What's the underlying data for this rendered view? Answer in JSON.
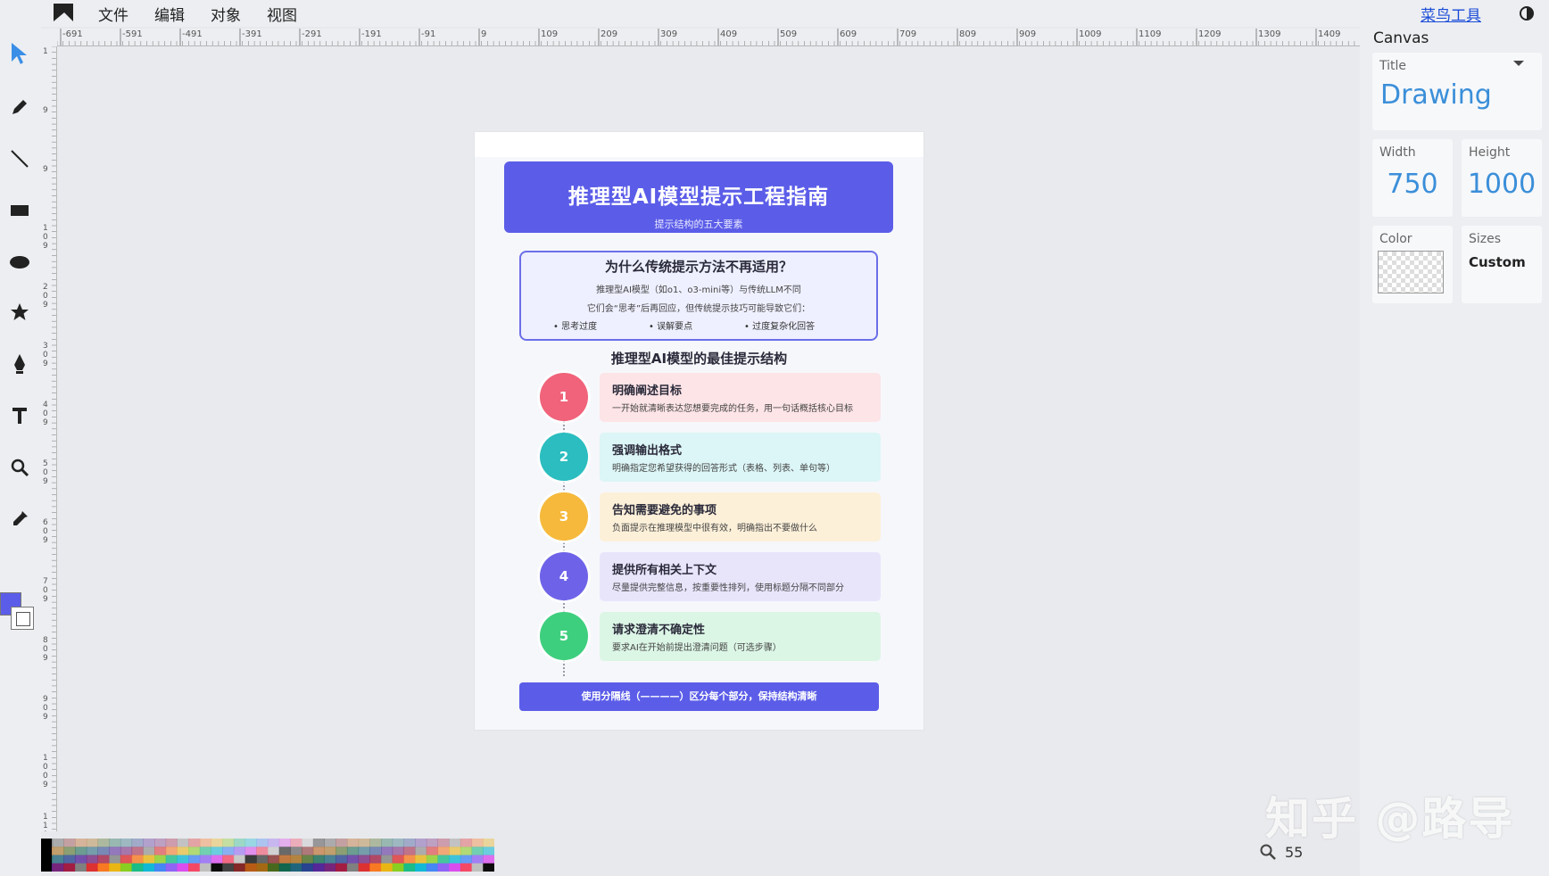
{
  "menubar": {
    "items": [
      "文件",
      "编辑",
      "对象",
      "视图"
    ],
    "brand_link": "菜鸟工具"
  },
  "tools": [
    "select-icon",
    "pencil-icon",
    "line-icon",
    "rectangle-icon",
    "ellipse-icon",
    "star-icon",
    "pen-icon",
    "text-icon",
    "zoom-icon",
    "eyedropper-icon"
  ],
  "rulers": {
    "h_labels": [
      "-691",
      "-591",
      "-491",
      "-391",
      "-291",
      "-191",
      "-91",
      "9",
      "109",
      "209",
      "309",
      "409",
      "509",
      "609",
      "709",
      "809",
      "909",
      "1009",
      "1109",
      "1209",
      "1309",
      "1409"
    ],
    "v_labels": [
      "1",
      "9",
      "9",
      "1 0 9",
      "2 0 9",
      "3 0 9",
      "4 0 9",
      "5 0 9",
      "6 0 9",
      "7 0 9",
      "8 0 9",
      "9 0 9",
      "1 0 0 9",
      "1 1 0 9"
    ]
  },
  "canvas_panel": {
    "heading": "Canvas",
    "title_label": "Title",
    "title_value": "Drawing",
    "width_label": "Width",
    "width_value": "750",
    "height_label": "Height",
    "height_value": "1000",
    "color_label": "Color",
    "sizes_label": "Sizes",
    "sizes_value": "Custom"
  },
  "poster": {
    "title": "推理型AI模型提示工程指南",
    "subtitle": "提示结构的五大要素",
    "why": {
      "title": "为什么传统提示方法不再适用？",
      "line1": "推理型AI模型（如o1、o3-mini等）与传统LLM不同",
      "line2": "它们会“思考”后再回应，但传统提示技巧可能导致它们：",
      "bullets": [
        "• 思考过度",
        "• 误解要点",
        "• 过度复杂化回答"
      ]
    },
    "section_title": "推理型AI模型的最佳提示结构",
    "steps": [
      {
        "num": "1",
        "title": "明确阐述目标",
        "desc": "一开始就清晰表达您想要完成的任务，用一句话概括核心目标",
        "color": "#f0637a",
        "card": "#fde4e7"
      },
      {
        "num": "2",
        "title": "强调输出格式",
        "desc": "明确指定您希望获得的回答形式（表格、列表、单句等）",
        "color": "#2bbdbf",
        "card": "#dcf5f6"
      },
      {
        "num": "3",
        "title": "告知需要避免的事项",
        "desc": "负面提示在推理模型中很有效，明确指出不要做什么",
        "color": "#f6b93b",
        "card": "#fdf0d9"
      },
      {
        "num": "4",
        "title": "提供所有相关上下文",
        "desc": "尽量提供完整信息，按重要性排列，使用标题分隔不同部分",
        "color": "#6e63e8",
        "card": "#e8e5fb"
      },
      {
        "num": "5",
        "title": "请求澄清不确定性",
        "desc": "要求AI在开始前提出澄清问题（可选步骤）",
        "color": "#3ecf7e",
        "card": "#dcf6e6"
      }
    ],
    "footer": "使用分隔线（————）区分每个部分，保持结构清晰"
  },
  "status": {
    "zoom": "55"
  },
  "watermark": "知乎 @路导",
  "colors": {
    "accent": "#5b5de8",
    "link": "#1a4bd8",
    "panel_value": "#3b8fd9"
  }
}
